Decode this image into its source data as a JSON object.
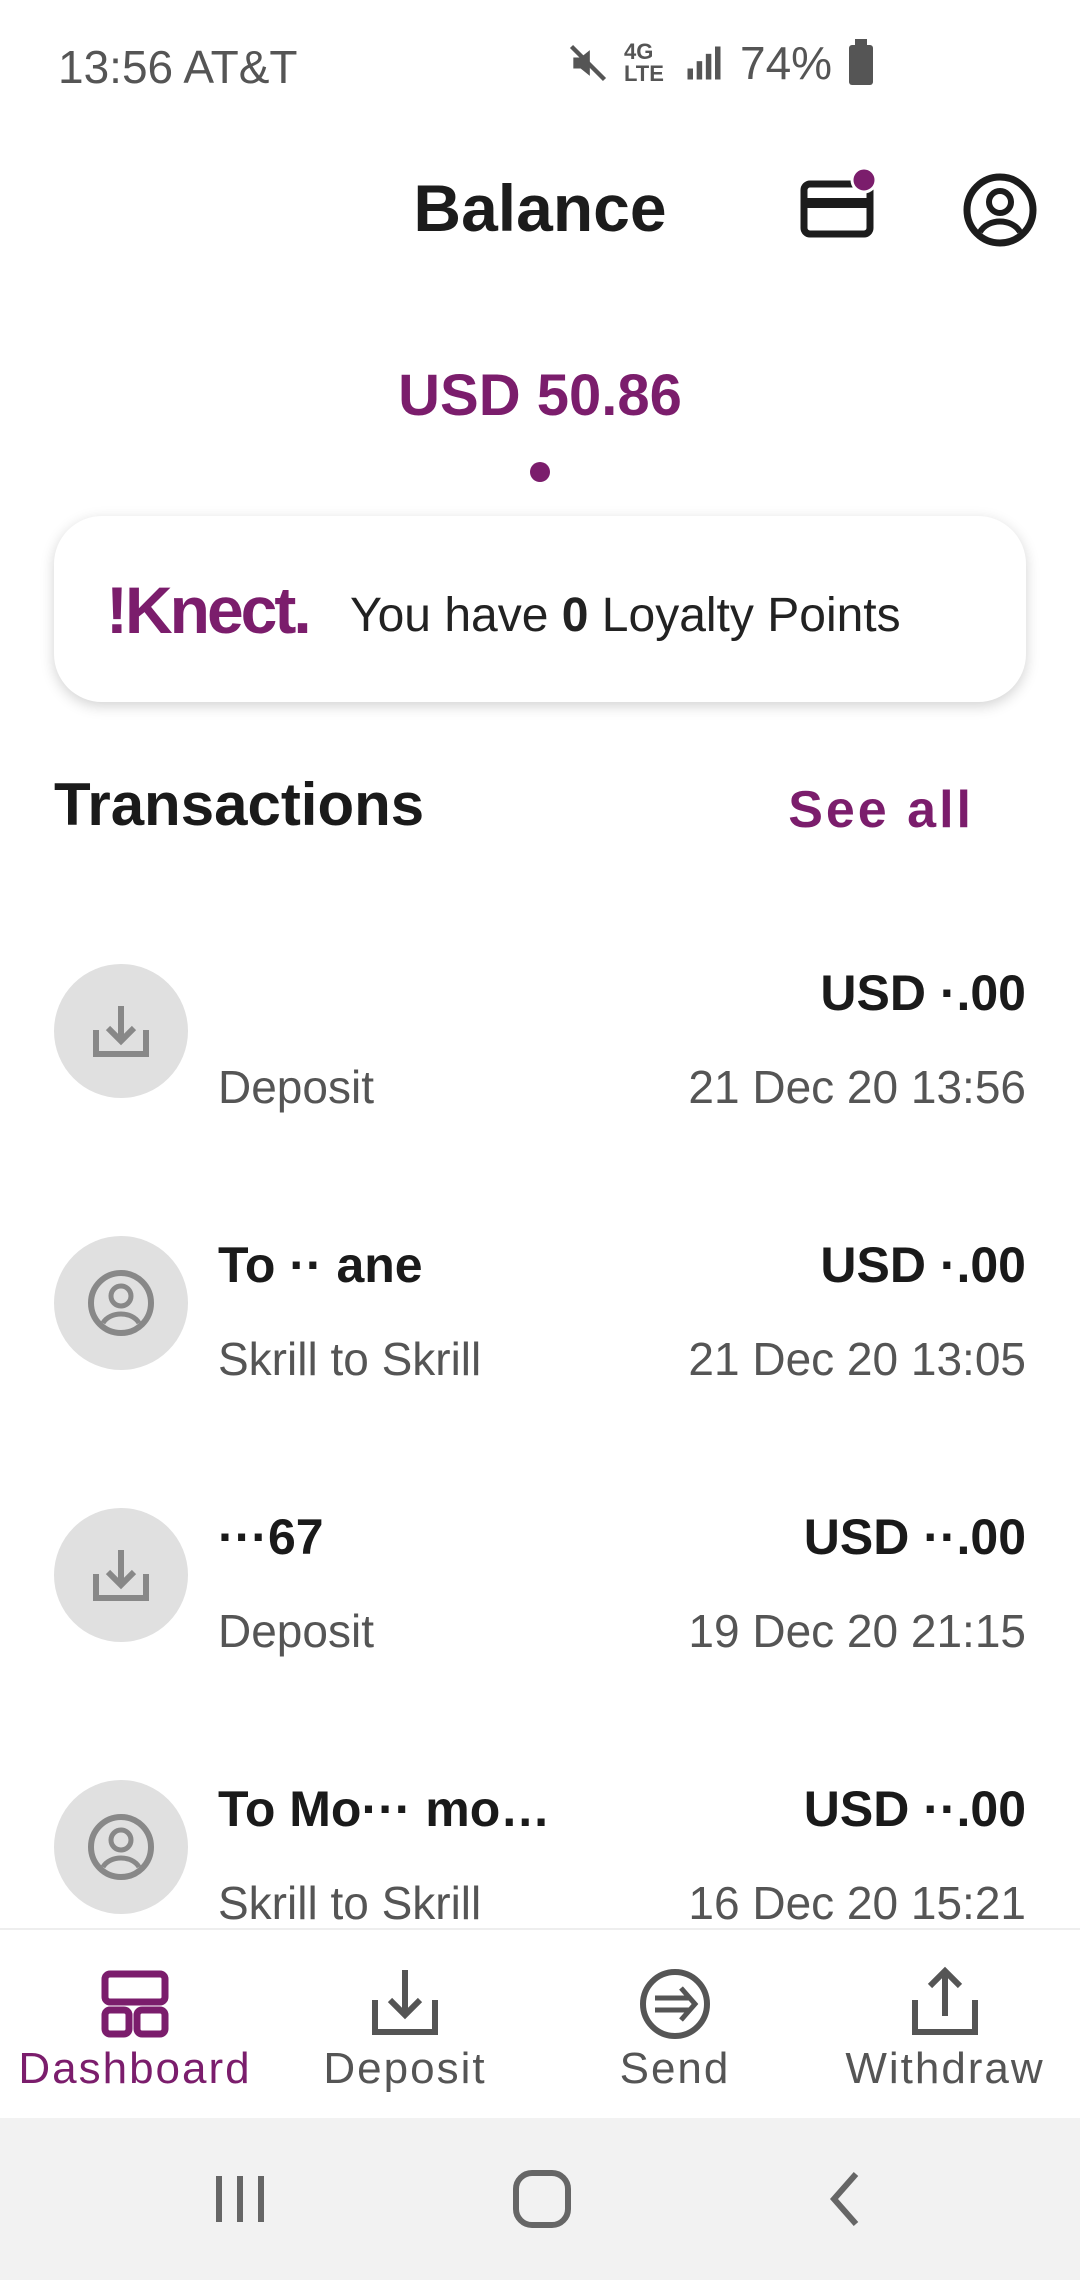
{
  "status_bar": {
    "time_carrier": "13:56 AT&T",
    "network": "4G LTE",
    "battery": "74%"
  },
  "header": {
    "title": "Balance"
  },
  "balance": {
    "amount": "USD 50.86"
  },
  "loyalty": {
    "logo": "!Knect.",
    "prefix": "You have ",
    "points": "0",
    "suffix": " Loyalty Points"
  },
  "transactions": {
    "heading": "Transactions",
    "see_all": "See all",
    "items": [
      {
        "icon": "deposit-icon",
        "name": "",
        "amount": "USD ·.00",
        "type": "Deposit",
        "date": "21 Dec 20 13:56"
      },
      {
        "icon": "person-icon",
        "name": "To ·· ane",
        "amount": "USD ·.00",
        "type": "Skrill to Skrill",
        "date": "21 Dec 20 13:05"
      },
      {
        "icon": "deposit-icon",
        "name": "···67",
        "amount": "USD ··.00",
        "type": "Deposit",
        "date": "19 Dec 20 21:15"
      },
      {
        "icon": "person-icon",
        "name": "To Mo··· mo…",
        "amount": "USD ··.00",
        "type": "Skrill to Skrill",
        "date": "16 Dec 20 15:21"
      }
    ]
  },
  "bottom_nav": {
    "items": [
      {
        "label": "Dashboard",
        "icon": "dashboard-icon",
        "active": true
      },
      {
        "label": "Deposit",
        "icon": "deposit-icon",
        "active": false
      },
      {
        "label": "Send",
        "icon": "send-icon",
        "active": false
      },
      {
        "label": "Withdraw",
        "icon": "withdraw-icon",
        "active": false
      }
    ]
  },
  "colors": {
    "accent": "#7b1d6c",
    "text": "#1a1a1a",
    "muted": "#555555",
    "avatar_bg": "#e0e0e0"
  }
}
